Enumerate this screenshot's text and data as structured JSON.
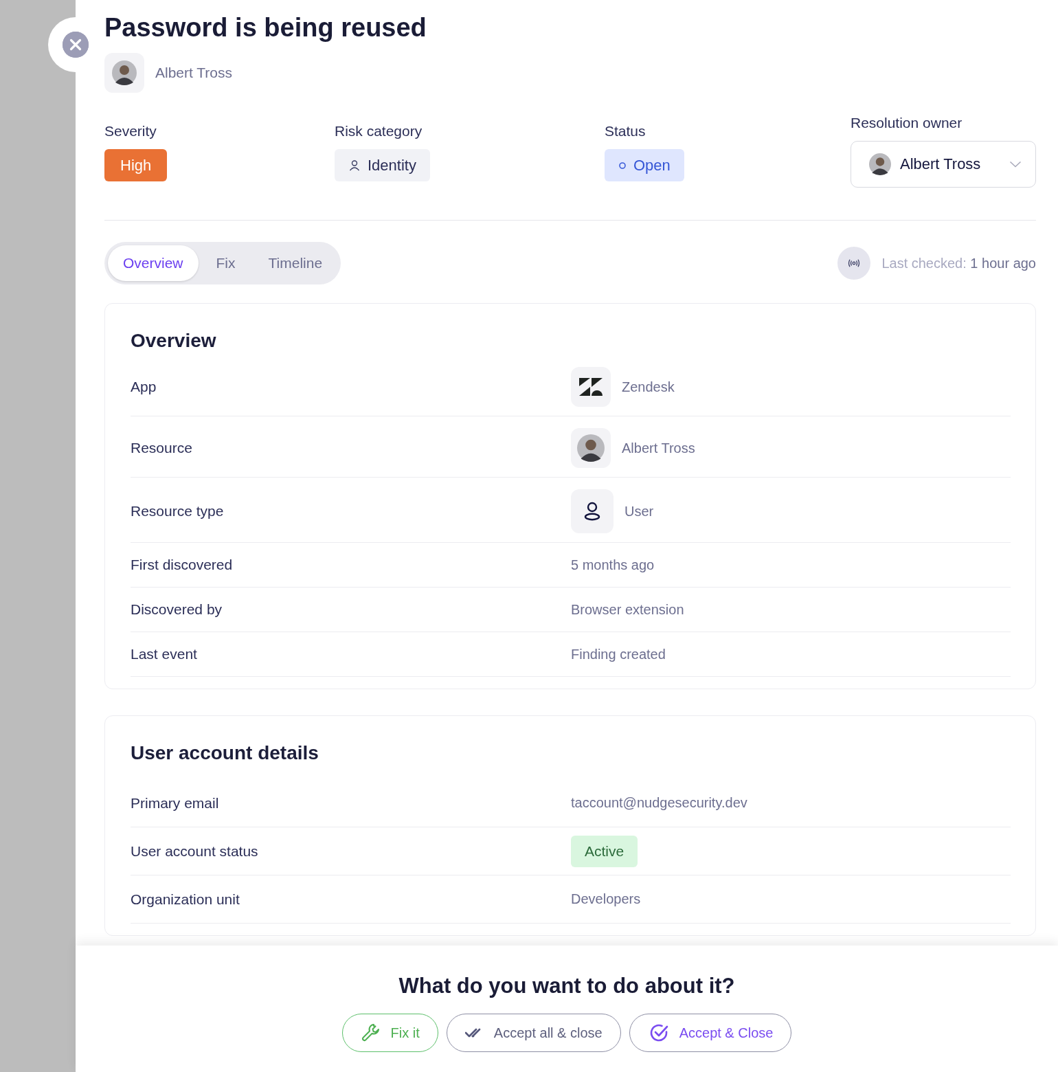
{
  "title": "Password is being reused",
  "author": {
    "name": "Albert Tross"
  },
  "fields": [
    {
      "label": "Severity",
      "value": "High",
      "kind": "severity"
    },
    {
      "label": "Risk category",
      "value": "Identity",
      "kind": "category"
    },
    {
      "label": "Status",
      "value": "Open",
      "kind": "status"
    },
    {
      "label": "Resolution owner",
      "value": "Albert Tross",
      "kind": "owner"
    }
  ],
  "tabs": [
    {
      "label": "Overview",
      "selected": true
    },
    {
      "label": "Fix",
      "selected": false
    },
    {
      "label": "Timeline",
      "selected": false
    }
  ],
  "last_checked": {
    "label": "Last checked:",
    "value": "1 hour ago"
  },
  "sections": [
    {
      "title": "Overview",
      "rows": [
        {
          "label": "App",
          "value": "Zendesk",
          "kind": "app"
        },
        {
          "label": "Resource",
          "value": "Albert Tross",
          "kind": "person"
        },
        {
          "label": "Resource type",
          "value": "User",
          "kind": "user"
        },
        {
          "label": "First discovered",
          "value": "5 months ago",
          "kind": "text"
        },
        {
          "label": "Discovered by",
          "value": "Browser extension",
          "kind": "text"
        },
        {
          "label": "Last event",
          "value": "Finding created",
          "kind": "text"
        }
      ]
    },
    {
      "title": "User account details",
      "rows": [
        {
          "label": "Primary email",
          "value": "taccount@nudgesecurity.dev",
          "kind": "text"
        },
        {
          "label": "User account status",
          "value": "Active",
          "kind": "badge"
        },
        {
          "label": "Organization unit",
          "value": "Developers",
          "kind": "text"
        }
      ]
    }
  ],
  "footer": {
    "question": "What do you want to do about it?",
    "buttons": [
      {
        "label": "Fix it",
        "kind": "fix"
      },
      {
        "label": "Accept all & close",
        "kind": "accept_all"
      },
      {
        "label": "Accept & Close",
        "kind": "accept"
      }
    ]
  }
}
